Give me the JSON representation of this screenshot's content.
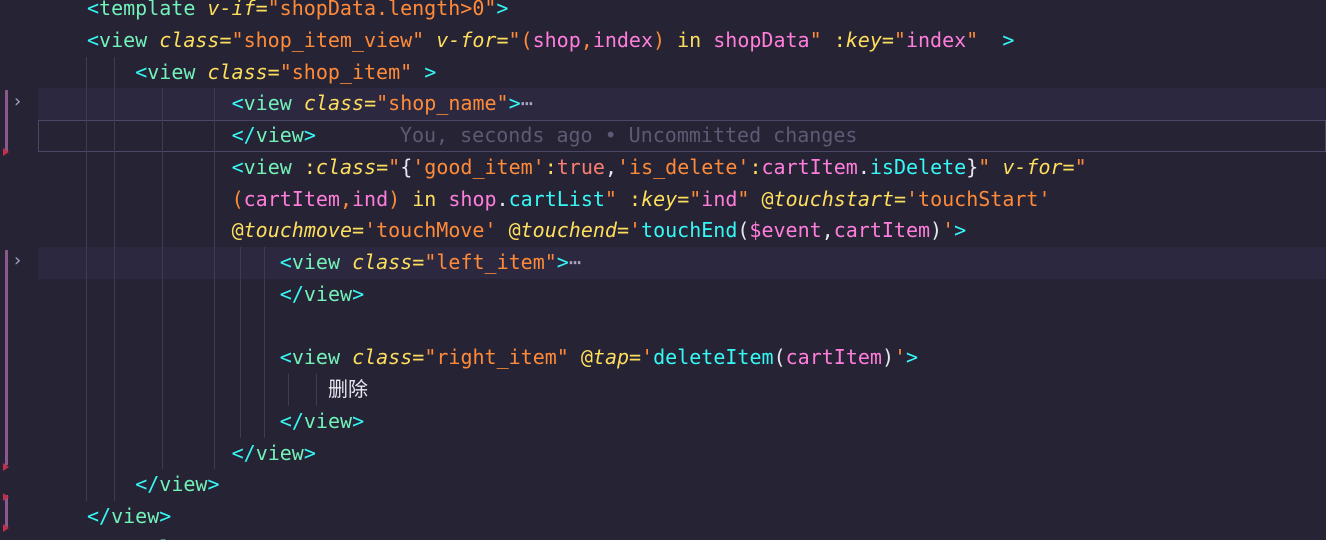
{
  "editor": {
    "blame": "You, seconds ago • Uncommitted changes",
    "fold_ellipsis": "⋯",
    "lines": [
      {
        "indent": 1,
        "tokens": [
          {
            "c": "t-punc",
            "t": "<"
          },
          {
            "c": "t-tag",
            "t": "template"
          },
          {
            "c": "t-text",
            "t": " "
          },
          {
            "c": "t-attr",
            "t": "v-if"
          },
          {
            "c": "t-op",
            "t": "="
          },
          {
            "c": "t-str",
            "t": "\"shopData.length>0\""
          },
          {
            "c": "t-punc",
            "t": ">"
          }
        ]
      },
      {
        "indent": 1,
        "tokens": [
          {
            "c": "t-punc",
            "t": "<"
          },
          {
            "c": "t-tag",
            "t": "view"
          },
          {
            "c": "t-text",
            "t": " "
          },
          {
            "c": "t-attr",
            "t": "class"
          },
          {
            "c": "t-op",
            "t": "="
          },
          {
            "c": "t-str",
            "t": "\"shop_item_view\""
          },
          {
            "c": "t-text",
            "t": " "
          },
          {
            "c": "t-attr",
            "t": "v-for"
          },
          {
            "c": "t-op",
            "t": "="
          },
          {
            "c": "t-str",
            "t": "\"("
          },
          {
            "c": "t-var",
            "t": "shop"
          },
          {
            "c": "t-str",
            "t": ","
          },
          {
            "c": "t-var",
            "t": "index"
          },
          {
            "c": "t-str",
            "t": ") "
          },
          {
            "c": "t-kw",
            "t": "in"
          },
          {
            "c": "t-str",
            "t": " "
          },
          {
            "c": "t-var",
            "t": "shopData"
          },
          {
            "c": "t-str",
            "t": "\""
          },
          {
            "c": "t-text",
            "t": " "
          },
          {
            "c": "t-op",
            "t": ":"
          },
          {
            "c": "t-attr",
            "t": "key"
          },
          {
            "c": "t-op",
            "t": "="
          },
          {
            "c": "t-str",
            "t": "\""
          },
          {
            "c": "t-var",
            "t": "index"
          },
          {
            "c": "t-str",
            "t": "\""
          },
          {
            "c": "t-text",
            "t": "  "
          },
          {
            "c": "t-punc",
            "t": ">"
          }
        ]
      },
      {
        "indent": 2,
        "tokens": [
          {
            "c": "t-punc",
            "t": "<"
          },
          {
            "c": "t-tag",
            "t": "view"
          },
          {
            "c": "t-text",
            "t": " "
          },
          {
            "c": "t-attr",
            "t": "class"
          },
          {
            "c": "t-op",
            "t": "="
          },
          {
            "c": "t-str",
            "t": "\"shop_item\""
          },
          {
            "c": "t-text",
            "t": " "
          },
          {
            "c": "t-punc",
            "t": ">"
          }
        ]
      },
      {
        "indent": 4,
        "folded": true,
        "hl": true,
        "tokens": [
          {
            "c": "t-punc",
            "t": "<"
          },
          {
            "c": "t-tag",
            "t": "view"
          },
          {
            "c": "t-text",
            "t": " "
          },
          {
            "c": "t-attr",
            "t": "class"
          },
          {
            "c": "t-op",
            "t": "="
          },
          {
            "c": "t-str",
            "t": "\"shop_name\""
          },
          {
            "c": "t-punc",
            "t": ">"
          }
        ]
      },
      {
        "indent": 4,
        "cursor": true,
        "blame": true,
        "tokens": [
          {
            "c": "t-punc",
            "t": "</"
          },
          {
            "c": "t-tag",
            "t": "view"
          },
          {
            "c": "t-punc",
            "t": ">"
          }
        ]
      },
      {
        "indent": 4,
        "tokens": [
          {
            "c": "t-punc",
            "t": "<"
          },
          {
            "c": "t-tag",
            "t": "view"
          },
          {
            "c": "t-text",
            "t": " "
          },
          {
            "c": "t-op",
            "t": ":"
          },
          {
            "c": "t-attr",
            "t": "class"
          },
          {
            "c": "t-op",
            "t": "="
          },
          {
            "c": "t-str",
            "t": "\""
          },
          {
            "c": "t-text",
            "t": "{"
          },
          {
            "c": "t-str",
            "t": "'good_item'"
          },
          {
            "c": "t-op",
            "t": ":"
          },
          {
            "c": "t-bool",
            "t": "true"
          },
          {
            "c": "t-text",
            "t": ","
          },
          {
            "c": "t-str",
            "t": "'is_delete'"
          },
          {
            "c": "t-op",
            "t": ":"
          },
          {
            "c": "t-var",
            "t": "cartItem"
          },
          {
            "c": "t-text",
            "t": "."
          },
          {
            "c": "t-punc",
            "t": "isDelete"
          },
          {
            "c": "t-text",
            "t": "}"
          },
          {
            "c": "t-str",
            "t": "\""
          },
          {
            "c": "t-text",
            "t": " "
          },
          {
            "c": "t-attr",
            "t": "v-for"
          },
          {
            "c": "t-op",
            "t": "="
          },
          {
            "c": "t-str",
            "t": "\""
          }
        ]
      },
      {
        "indent": 4,
        "tokens": [
          {
            "c": "t-str",
            "t": "("
          },
          {
            "c": "t-var",
            "t": "cartItem"
          },
          {
            "c": "t-str",
            "t": ","
          },
          {
            "c": "t-var",
            "t": "ind"
          },
          {
            "c": "t-str",
            "t": ") "
          },
          {
            "c": "t-kw",
            "t": "in"
          },
          {
            "c": "t-str",
            "t": " "
          },
          {
            "c": "t-var",
            "t": "shop"
          },
          {
            "c": "t-text",
            "t": "."
          },
          {
            "c": "t-punc",
            "t": "cartList"
          },
          {
            "c": "t-str",
            "t": "\""
          },
          {
            "c": "t-text",
            "t": " "
          },
          {
            "c": "t-op",
            "t": ":"
          },
          {
            "c": "t-attr",
            "t": "key"
          },
          {
            "c": "t-op",
            "t": "="
          },
          {
            "c": "t-str",
            "t": "\""
          },
          {
            "c": "t-var",
            "t": "ind"
          },
          {
            "c": "t-str",
            "t": "\""
          },
          {
            "c": "t-text",
            "t": " "
          },
          {
            "c": "t-op",
            "t": "@"
          },
          {
            "c": "t-attr",
            "t": "touchstart"
          },
          {
            "c": "t-op",
            "t": "="
          },
          {
            "c": "t-str",
            "t": "'touchStart'"
          }
        ]
      },
      {
        "indent": 4,
        "tokens": [
          {
            "c": "t-op",
            "t": "@"
          },
          {
            "c": "t-attr",
            "t": "touchmove"
          },
          {
            "c": "t-op",
            "t": "="
          },
          {
            "c": "t-str",
            "t": "'touchMove'"
          },
          {
            "c": "t-text",
            "t": " "
          },
          {
            "c": "t-op",
            "t": "@"
          },
          {
            "c": "t-attr",
            "t": "touchend"
          },
          {
            "c": "t-op",
            "t": "="
          },
          {
            "c": "t-str",
            "t": "'"
          },
          {
            "c": "t-punc",
            "t": "touchEnd"
          },
          {
            "c": "t-text",
            "t": "("
          },
          {
            "c": "t-var",
            "t": "$event"
          },
          {
            "c": "t-text",
            "t": ","
          },
          {
            "c": "t-var",
            "t": "cartItem"
          },
          {
            "c": "t-text",
            "t": ")"
          },
          {
            "c": "t-str",
            "t": "'"
          },
          {
            "c": "t-punc",
            "t": ">"
          }
        ]
      },
      {
        "indent": 5,
        "folded": true,
        "hl": true,
        "tokens": [
          {
            "c": "t-punc",
            "t": "<"
          },
          {
            "c": "t-tag",
            "t": "view"
          },
          {
            "c": "t-text",
            "t": " "
          },
          {
            "c": "t-attr",
            "t": "class"
          },
          {
            "c": "t-op",
            "t": "="
          },
          {
            "c": "t-str",
            "t": "\"left_item\""
          },
          {
            "c": "t-punc",
            "t": ">"
          }
        ]
      },
      {
        "indent": 5,
        "tokens": [
          {
            "c": "t-punc",
            "t": "</"
          },
          {
            "c": "t-tag",
            "t": "view"
          },
          {
            "c": "t-punc",
            "t": ">"
          }
        ]
      },
      {
        "indent": 5,
        "tokens": []
      },
      {
        "indent": 5,
        "tokens": [
          {
            "c": "t-punc",
            "t": "<"
          },
          {
            "c": "t-tag",
            "t": "view"
          },
          {
            "c": "t-text",
            "t": " "
          },
          {
            "c": "t-attr",
            "t": "class"
          },
          {
            "c": "t-op",
            "t": "="
          },
          {
            "c": "t-str",
            "t": "\"right_item\""
          },
          {
            "c": "t-text",
            "t": " "
          },
          {
            "c": "t-op",
            "t": "@"
          },
          {
            "c": "t-attr",
            "t": "tap"
          },
          {
            "c": "t-op",
            "t": "="
          },
          {
            "c": "t-str",
            "t": "'"
          },
          {
            "c": "t-punc",
            "t": "deleteItem"
          },
          {
            "c": "t-text",
            "t": "("
          },
          {
            "c": "t-var",
            "t": "cartItem"
          },
          {
            "c": "t-text",
            "t": ")"
          },
          {
            "c": "t-str",
            "t": "'"
          },
          {
            "c": "t-punc",
            "t": ">"
          }
        ]
      },
      {
        "indent": 6,
        "tokens": [
          {
            "c": "t-text",
            "t": "删除"
          }
        ]
      },
      {
        "indent": 5,
        "tokens": [
          {
            "c": "t-punc",
            "t": "</"
          },
          {
            "c": "t-tag",
            "t": "view"
          },
          {
            "c": "t-punc",
            "t": ">"
          }
        ]
      },
      {
        "indent": 4,
        "tokens": [
          {
            "c": "t-punc",
            "t": "</"
          },
          {
            "c": "t-tag",
            "t": "view"
          },
          {
            "c": "t-punc",
            "t": ">"
          }
        ]
      },
      {
        "indent": 2,
        "tokens": [
          {
            "c": "t-punc",
            "t": "</"
          },
          {
            "c": "t-tag",
            "t": "view"
          },
          {
            "c": "t-punc",
            "t": ">"
          }
        ]
      },
      {
        "indent": 1,
        "tokens": [
          {
            "c": "t-punc",
            "t": "</"
          },
          {
            "c": "t-tag",
            "t": "view"
          },
          {
            "c": "t-punc",
            "t": ">"
          }
        ]
      },
      {
        "indent": 1,
        "tokens": [
          {
            "c": "t-punc",
            "t": "</"
          },
          {
            "c": "t-tag",
            "t": "template"
          },
          {
            "c": "t-punc",
            "t": ">"
          }
        ]
      }
    ]
  }
}
